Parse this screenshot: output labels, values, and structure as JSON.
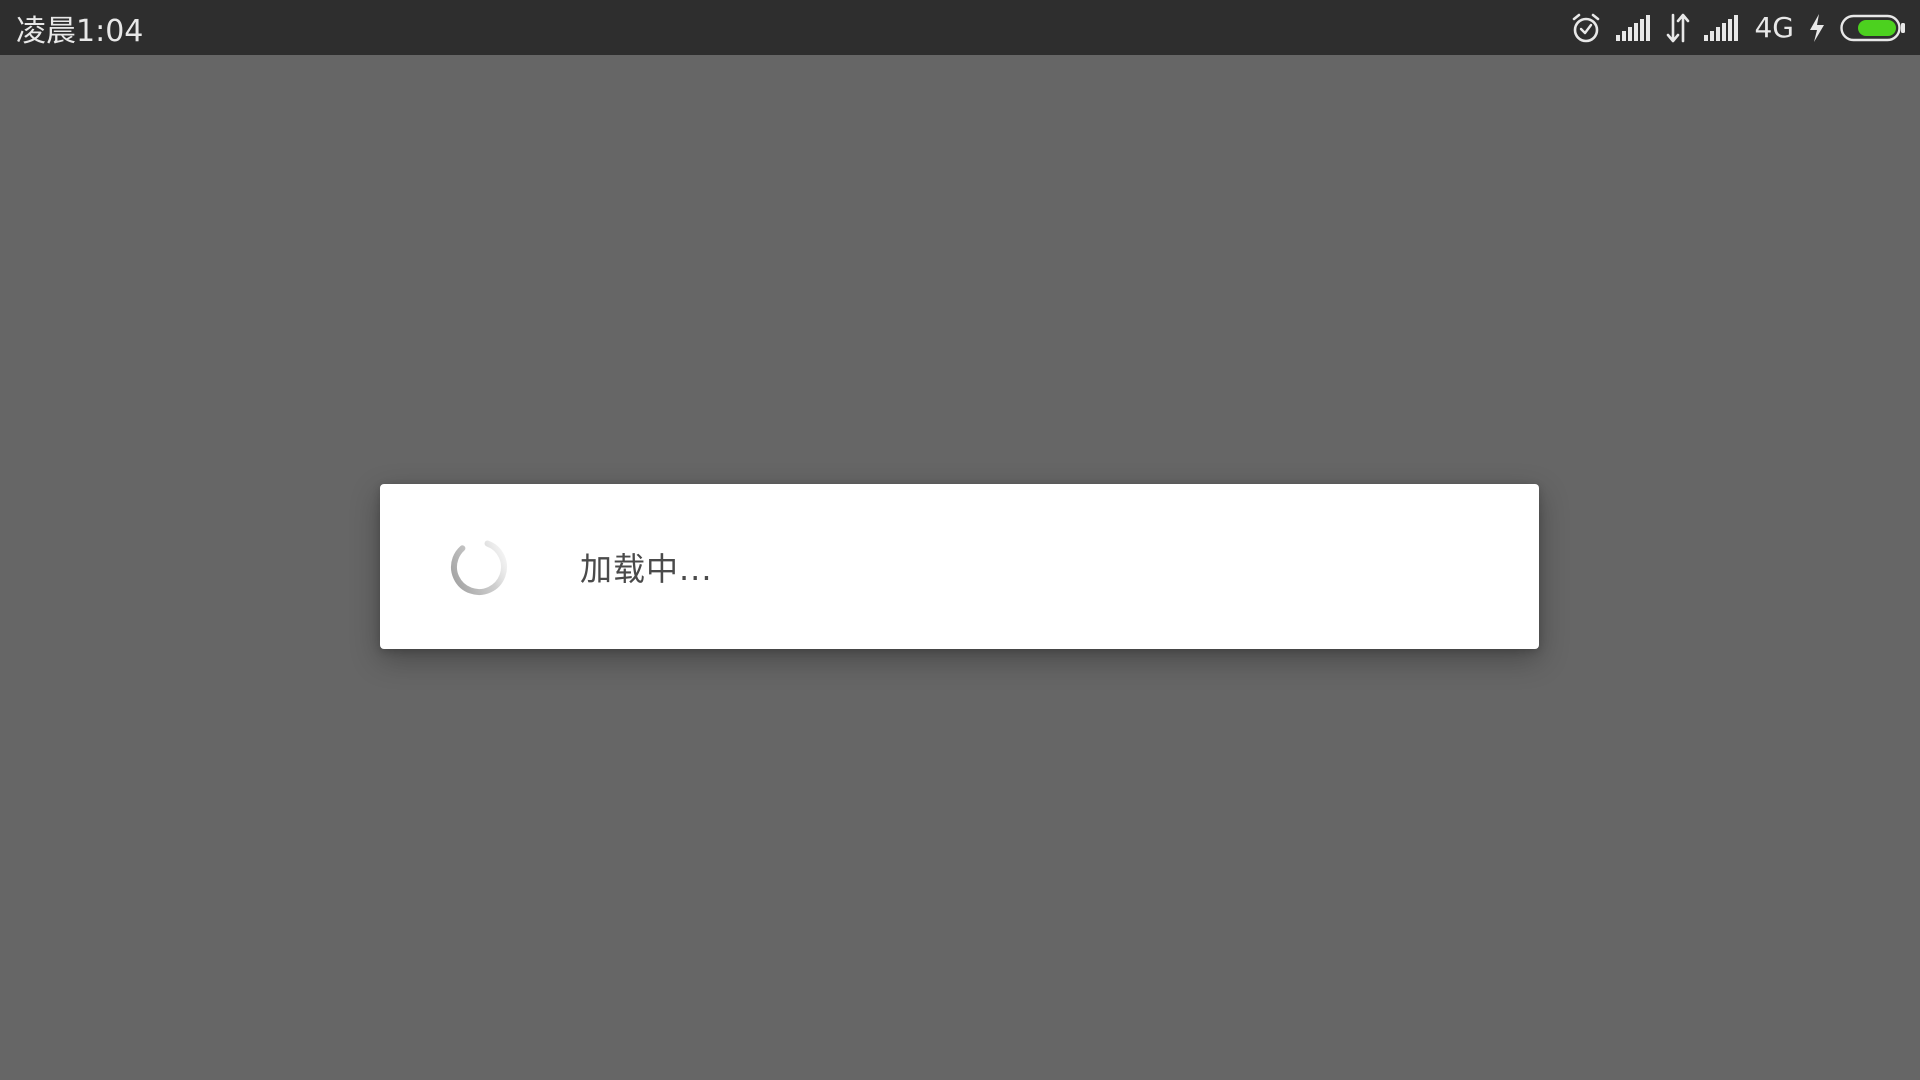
{
  "status_bar": {
    "time": "凌晨1:04",
    "network_type": "4G",
    "icons": [
      "alarm-clock-icon",
      "signal-strength-icon",
      "data-transfer-icon",
      "signal-strength-icon",
      "charging-bolt-icon",
      "battery-icon"
    ],
    "battery_color": "#4cd11f"
  },
  "dialog": {
    "message": "加载中..."
  }
}
